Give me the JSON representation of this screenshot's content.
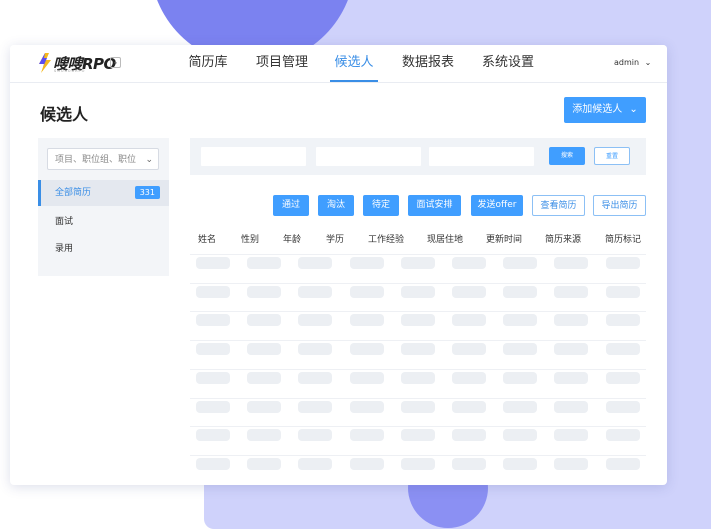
{
  "colors": {
    "accent": "#409eff",
    "background_panel": "#cfd2fb",
    "blob": "#7b82f0"
  },
  "header": {
    "logo_text": "嗖嗖RPO",
    "logo_subtext": "SOUSOURPO",
    "nav": [
      {
        "label": "简历库",
        "active": false
      },
      {
        "label": "项目管理",
        "active": false
      },
      {
        "label": "候选人",
        "active": true
      },
      {
        "label": "数据报表",
        "active": false
      },
      {
        "label": "系统设置",
        "active": false
      }
    ],
    "user": "admin",
    "user_icon": "chevron-down-icon"
  },
  "page": {
    "title": "候选人",
    "add_button": "添加候选人"
  },
  "sidebar": {
    "select_placeholder": "项目、职位组、职位",
    "items": [
      {
        "label": "全部简历",
        "count": "331",
        "active": true
      },
      {
        "label": "面试",
        "active": false
      },
      {
        "label": "录用",
        "active": false
      }
    ]
  },
  "filter": {
    "search_button": "搜索",
    "reset_button": "重置"
  },
  "actions": [
    "通过",
    "淘汰",
    "待定",
    "面试安排",
    "发送offer",
    "查看简历",
    "导出简历"
  ],
  "table": {
    "columns": [
      "姓名",
      "性别",
      "年龄",
      "学历",
      "工作经验",
      "现居住地",
      "更新时间",
      "简历来源",
      "简历标记"
    ],
    "row_count": 8
  }
}
